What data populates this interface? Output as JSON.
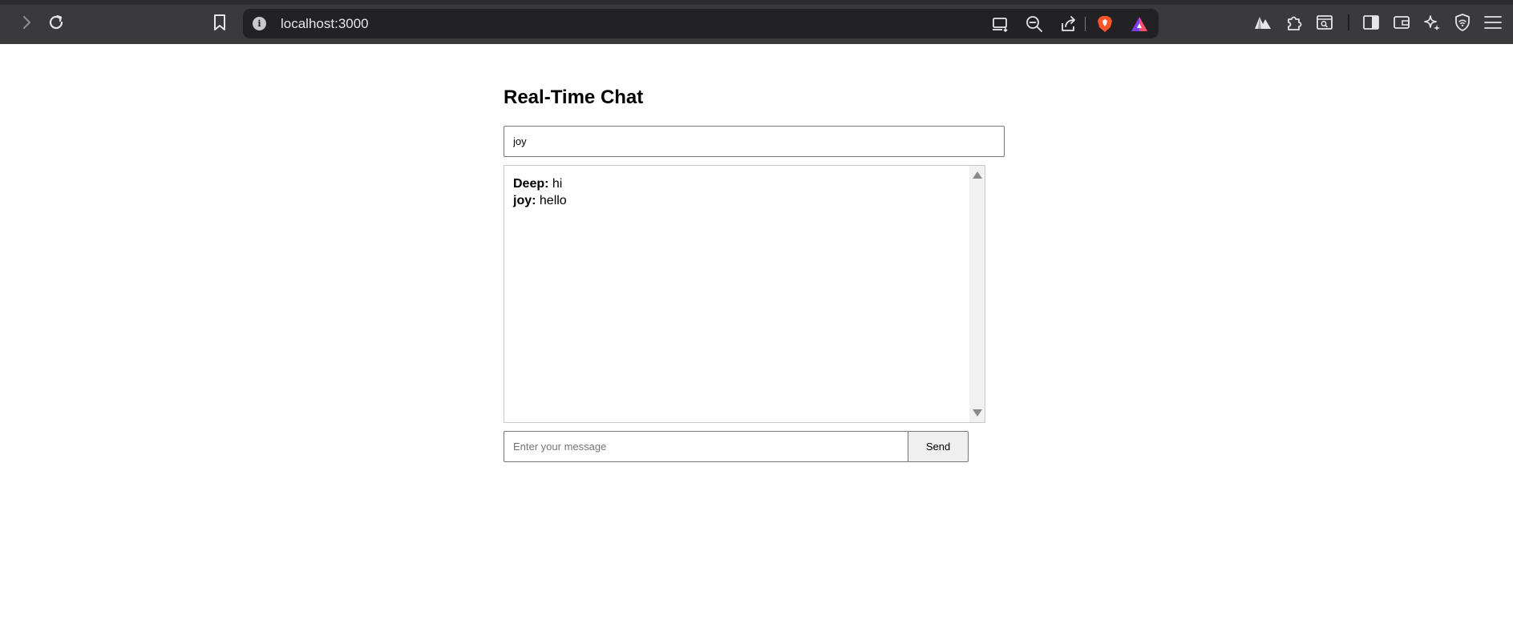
{
  "browser": {
    "url": "localhost:3000",
    "url_info_glyph": "i",
    "nav_icons": [
      "forward-icon",
      "reload-icon",
      "bookmark-icon"
    ],
    "url_icons": [
      "cast-icon",
      "zoom-out-icon",
      "share-icon",
      "brave-shields-icon",
      "brave-rewards-icon"
    ],
    "toolbar_icons": [
      "leo-icon",
      "extensions-icon",
      "screenshot-icon",
      "sidebar-icon",
      "wallet-icon",
      "ai-sparkle-icon",
      "vpn-icon",
      "menu-icon"
    ],
    "colors": {
      "chrome_bg": "#3a3a3c",
      "urlbar_bg": "#222224",
      "brave_orange": "#fb542b",
      "rewards_purple": "#7b3fe4"
    }
  },
  "app": {
    "title": "Real-Time Chat",
    "username_value": "joy",
    "messages": [
      {
        "user": "Deep:",
        "text": " hi"
      },
      {
        "user": "joy:",
        "text": " hello"
      }
    ],
    "message_placeholder": "Enter your message",
    "send_label": "Send"
  }
}
